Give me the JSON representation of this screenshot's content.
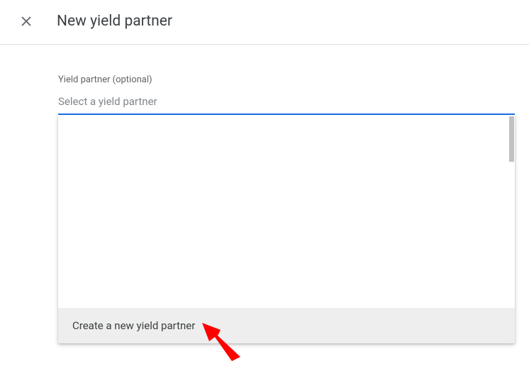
{
  "header": {
    "title": "New yield partner"
  },
  "form": {
    "field_label": "Yield partner (optional)",
    "select_placeholder": "Select a yield partner"
  },
  "dropdown": {
    "create_label": "Create a new yield partner"
  }
}
